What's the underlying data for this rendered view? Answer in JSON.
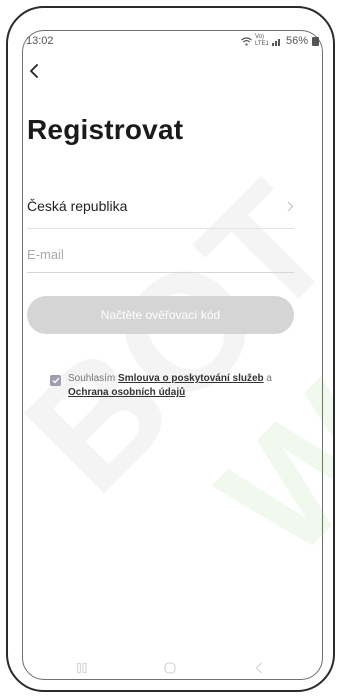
{
  "status_bar": {
    "time": "13:02",
    "network": "Vo) LTE1",
    "battery": "56%"
  },
  "header": {
    "title": "Registrovat"
  },
  "form": {
    "country_label": "Česká republika",
    "email_placeholder": "E-mail",
    "email_value": "",
    "code_button_label": "Načtěte ověřovací kód"
  },
  "agreement": {
    "checked": true,
    "prefix": "Souhlasím",
    "terms_link": "Smlouva o poskytování služeb",
    "conjunction": "a",
    "privacy_link": "Ochrana osobních údajů"
  },
  "icons": {
    "back": "chevron-left-icon",
    "country_chevron": "chevron-right-icon",
    "wifi": "wifi-icon",
    "signal": "signal-icon",
    "battery": "battery-icon",
    "checkbox": "check-icon",
    "nav_recents": "recents-icon",
    "nav_home": "home-icon",
    "nav_back": "back-icon"
  },
  "colors": {
    "button_disabled_bg": "#d5d5d5",
    "checkbox_bg": "#9e9eb0",
    "watermark_green": "#78c85a"
  }
}
